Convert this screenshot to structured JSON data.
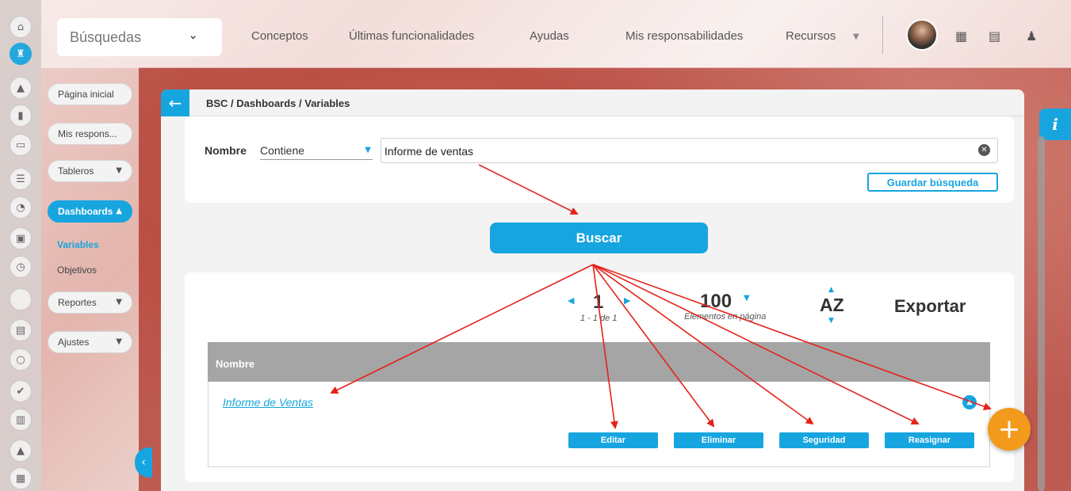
{
  "colors": {
    "accent": "#17a5df",
    "fab": "#f39a1c",
    "table_header": "#a5a5a5",
    "annotation_arrow": "#e4231b"
  },
  "rail": {
    "icons": [
      "home-icon",
      "castle-icon",
      "pyramid-icon",
      "bar-chart-icon",
      "presentation-icon",
      "list-icon",
      "pie-chart-icon",
      "book-icon",
      "clock-icon",
      "blank-icon",
      "document-icon",
      "cycle-icon",
      "check-icon",
      "briefcase-icon",
      "warning-icon",
      "calendar-icon"
    ]
  },
  "topbar": {
    "search_label": "Búsquedas",
    "nav": [
      "Conceptos",
      "Últimas funcionalidades",
      "Ayudas",
      "Mis responsabilidades",
      "Recursos"
    ],
    "icons": [
      "calendar-icon",
      "books-icon",
      "bell-icon"
    ]
  },
  "sidebar": {
    "home": "Página inicial",
    "responsibilities": "Mis respons...",
    "boards": "Tableros",
    "dashboards": "Dashboards",
    "variables": "Variables",
    "objectives": "Objetivos",
    "reports": "Reportes",
    "settings": "Ajustes"
  },
  "breadcrumb": "BSC / Dashboards / Variables",
  "filter": {
    "field_label": "Nombre",
    "operator": "Contiene",
    "value": "Informe de ventas",
    "save_label": "Guardar búsqueda"
  },
  "search_button": "Buscar",
  "pagination": {
    "page": "1",
    "range": "1 - 1 de 1",
    "per_page": "100",
    "per_page_label": "Elementos en página",
    "sort": "AZ",
    "export": "Exportar"
  },
  "table": {
    "column": "Nombre",
    "rows": [
      {
        "name": "Informe de Ventas",
        "actions": [
          "Editar",
          "Eliminar",
          "Seguridad",
          "Reasignar"
        ]
      }
    ]
  },
  "info_label": "i",
  "fab_label": "+"
}
